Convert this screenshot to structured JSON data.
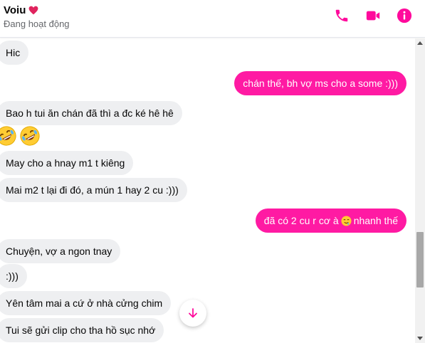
{
  "header": {
    "name": "Voiu",
    "heart_emoji": "red-heart",
    "status": "Đang hoạt động",
    "accent": "#ff0a9c",
    "actions": [
      "phone-icon",
      "video-camera-icon",
      "info-icon"
    ]
  },
  "messages": [
    {
      "direction": "in",
      "text": "Hic"
    },
    {
      "direction": "out",
      "text": "chán thế, bh vợ ms cho a some :)))"
    },
    {
      "direction": "in",
      "text": "Bao h tui ăn chán đã thì a đc ké hê hê"
    },
    {
      "direction": "in",
      "emojis": [
        "rolling-on-floor-laughing",
        "rolling-on-floor-laughing"
      ]
    },
    {
      "direction": "in",
      "text": "May cho a hnay m1 t kiêng"
    },
    {
      "direction": "in",
      "text": "Mai m2 t lại đi đó, a mún 1 hay 2 cu :)))"
    },
    {
      "direction": "out",
      "text_before": "đã có 2 cu r cơ à",
      "emoji": "drooling-face",
      "text_after": "nhanh thế"
    },
    {
      "direction": "in",
      "text": "Chuyện, vợ a ngon tnay"
    },
    {
      "direction": "in",
      "text": ":)))"
    },
    {
      "direction": "in",
      "text": "Yên tâm mai a cứ ở nhà cửng chim"
    },
    {
      "direction": "in",
      "text": "Tui sẽ gửi clip cho tha hồ sục nhớ"
    }
  ],
  "colors": {
    "outgoing_bubble": "#ff1aa3",
    "incoming_bubble": "#eeeff1",
    "text": "#050505",
    "muted": "#65676b"
  },
  "scroll_button_icon": "arrow-down-icon"
}
